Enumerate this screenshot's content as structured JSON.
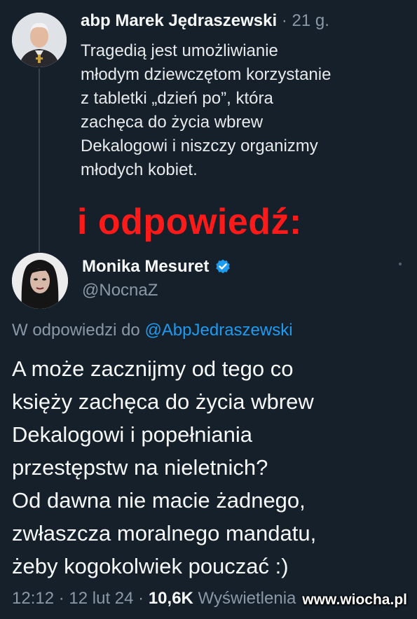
{
  "tweet1": {
    "author_name": "abp Marek Jędraszewski",
    "separator": "·",
    "time": "21 g.",
    "text": "Tragedią jest umożliwianie\nmłodym dziewczętom korzystanie\nz tabletki „dzień po”, która\nzachęca do życia wbrew\nDekalogowi i niszczy organizmy\nmłodych kobiet."
  },
  "overlay_caption": "i odpowiedź:",
  "tweet2": {
    "author_name": "Monika Mesuret",
    "handle": "@NocnaZ",
    "reply_prefix": "W odpowiedzi do",
    "reply_handle": "@AbpJedraszewski",
    "text": "A może zacznijmy od tego co\nksięży zachęca do życia wbrew\nDekalogowi i popełniania\nprzestępstw na nieletnich?\nOd dawna nie macie żadnego,\nzwłaszcza moralnego mandatu,\nżeby kogokolwiek pouczać :)",
    "time": "12:12",
    "sep1": "·",
    "date": "12 lut 24",
    "sep2": "·",
    "views_count": "10,6K",
    "views_label": "Wyświetlenia"
  },
  "watermark": "www.wiocha.pl",
  "colors": {
    "background": "#15202b",
    "text": "#f7f9f9",
    "muted": "#8b98a5",
    "link": "#1d9bf0",
    "caption_red": "#ff1a1a"
  },
  "icons": {
    "verified": "verified-badge-icon",
    "more": "more-options-icon"
  }
}
